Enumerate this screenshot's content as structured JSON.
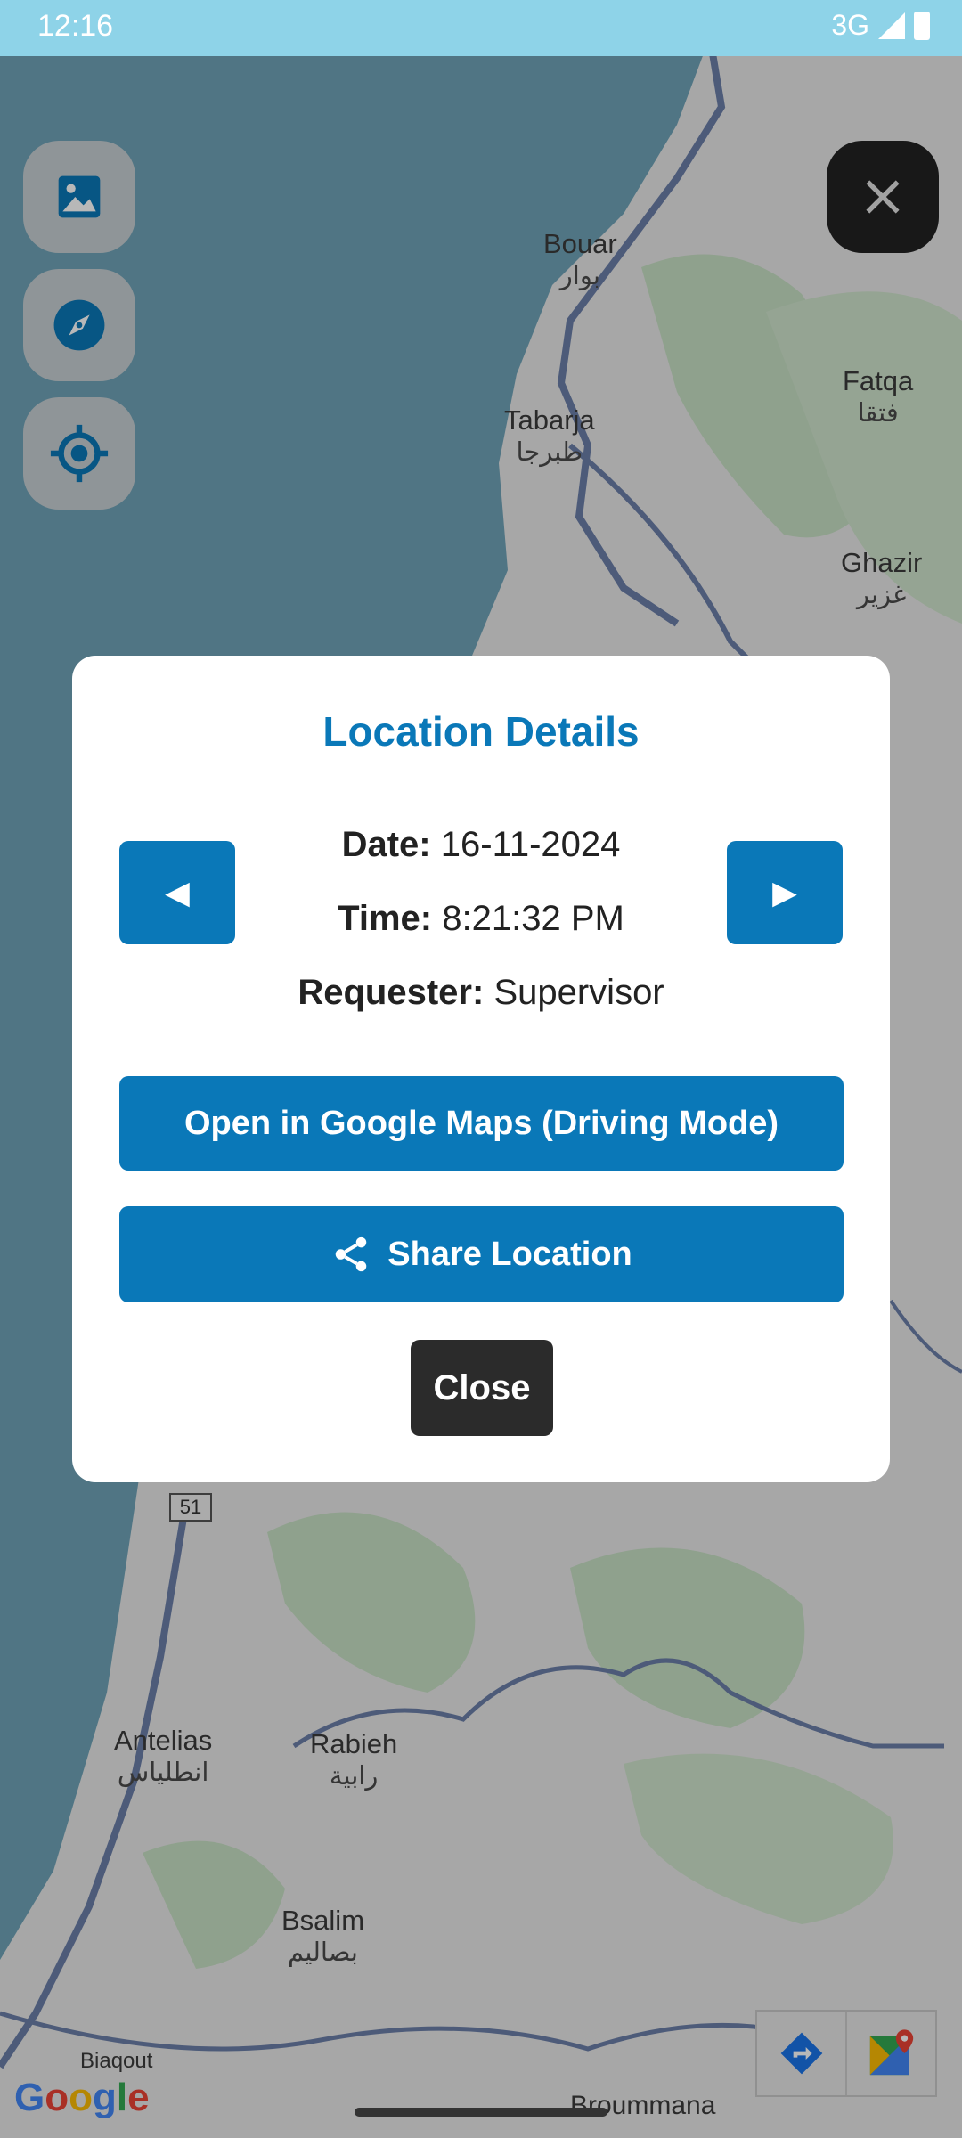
{
  "status_bar": {
    "time": "12:16",
    "network": "3G"
  },
  "map": {
    "places": [
      {
        "name": "Bouar",
        "arabic": "بوار"
      },
      {
        "name": "Tabarja",
        "arabic": "طبرجا"
      },
      {
        "name": "Fatqa",
        "arabic": "فتقا"
      },
      {
        "name": "Ghazir",
        "arabic": "غزير"
      },
      {
        "name": "Antelias",
        "arabic": "انطلياس"
      },
      {
        "name": "Rabieh",
        "arabic": "رابية"
      },
      {
        "name": "Bsalim",
        "arabic": "بصاليم"
      },
      {
        "name": "Biaqout",
        "arabic": ""
      },
      {
        "name": "Broummana",
        "arabic": ""
      }
    ],
    "route_shield": "51",
    "attribution": [
      "G",
      "o",
      "o",
      "g",
      "l",
      "e"
    ],
    "buttons": {
      "layers": "image-icon",
      "compass": "compass-icon",
      "my_location": "locate-icon",
      "close": "close-icon"
    },
    "colors": {
      "water": "#6fa3b8",
      "land": "#e8e8e8",
      "green": "#c6dfc4",
      "road": "#6b7fa8"
    }
  },
  "dialog": {
    "title": "Location Details",
    "prev_label": "◀",
    "next_label": "▶",
    "date_label": "Date:",
    "date_value": "16-11-2024",
    "time_label": "Time:",
    "time_value": "8:21:32 PM",
    "requester_label": "Requester:",
    "requester_value": "Supervisor",
    "open_maps_label": "Open in Google Maps (Driving Mode)",
    "share_label": "Share Location",
    "close_label": "Close",
    "accent": "#0a78b8"
  }
}
